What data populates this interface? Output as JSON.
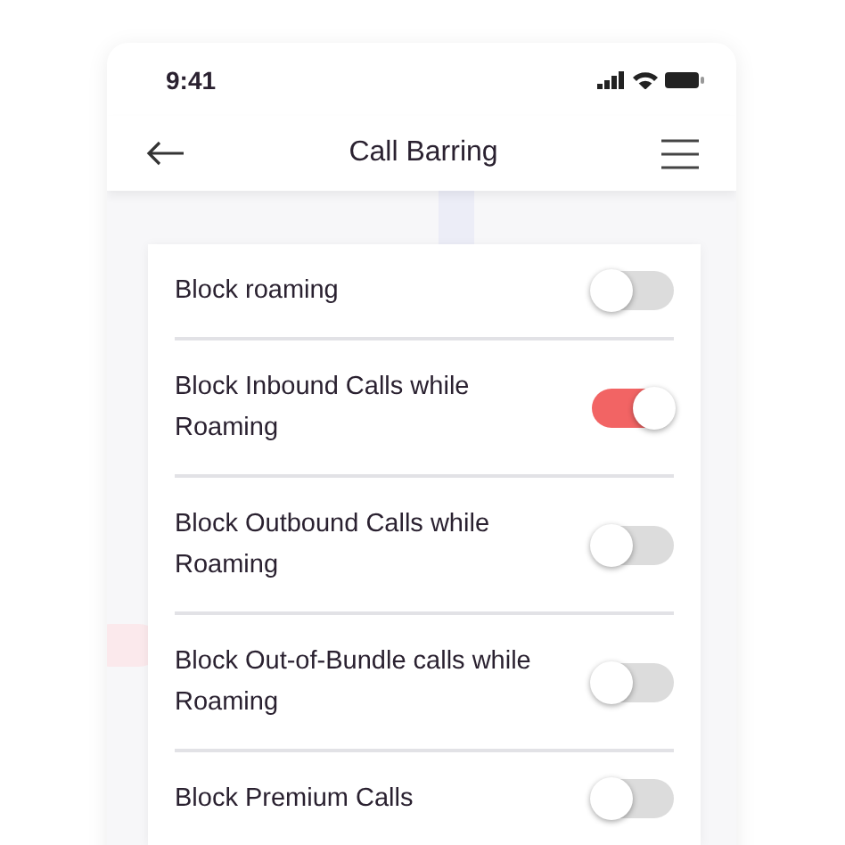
{
  "status_bar": {
    "time": "9:41"
  },
  "nav_bar": {
    "title": "Call Barring"
  },
  "settings": [
    {
      "label": "Block roaming",
      "on": false
    },
    {
      "label": "Block Inbound Calls while Roaming",
      "on": true
    },
    {
      "label": "Block Outbound Calls while Roaming",
      "on": false
    },
    {
      "label": "Block Out-of-Bundle calls while Roaming",
      "on": false
    },
    {
      "label": "Block Premium Calls",
      "on": false
    }
  ]
}
